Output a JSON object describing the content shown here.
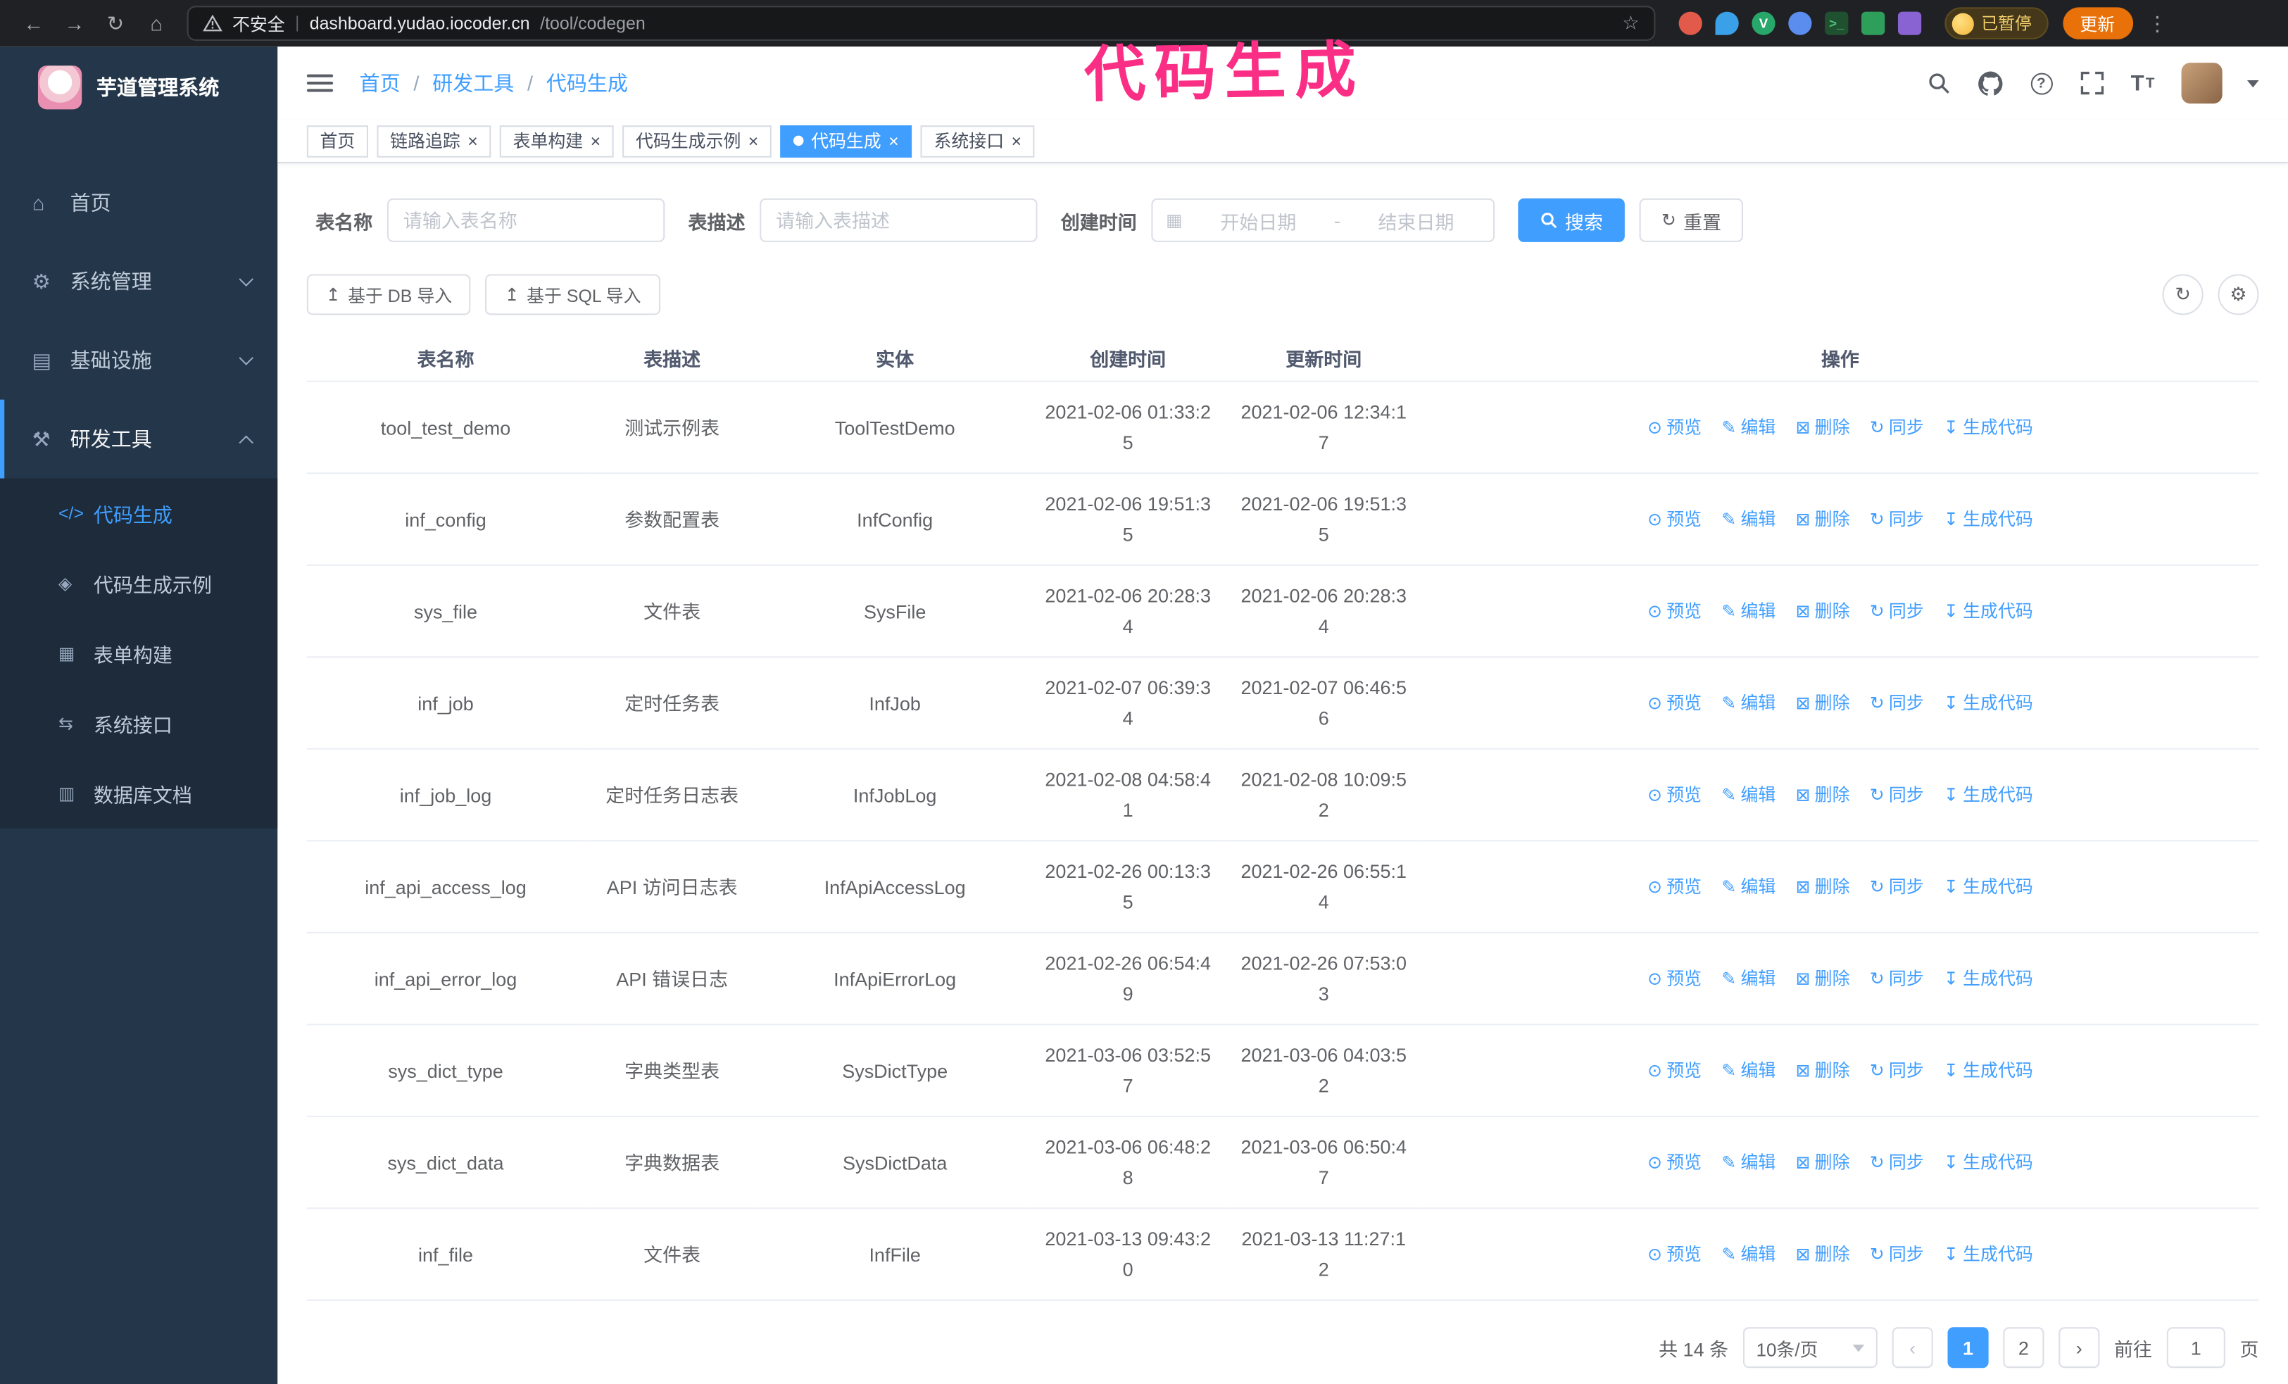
{
  "colors": {
    "accent": "#409eff",
    "annotation_pink": "#fb2e86",
    "sidebar_bg": "#24364a",
    "submenu_bg": "#1d2b3a",
    "update_button_orange": "#e8710a",
    "active_tab_blue": "#409eff"
  },
  "annotation": {
    "text": "代码生成"
  },
  "browser": {
    "security_label": "不安全",
    "url_host": "dashboard.yudao.iocoder.cn",
    "url_path": "/tool/codegen",
    "paused_badge": "已暂停",
    "update_button": "更新"
  },
  "sidebar": {
    "logo_title": "芋道管理系统",
    "items": [
      {
        "label": "首页",
        "icon": "home-icon"
      },
      {
        "label": "系统管理",
        "icon": "system-icon",
        "expandable": true
      },
      {
        "label": "基础设施",
        "icon": "infra-icon",
        "expandable": true
      },
      {
        "label": "研发工具",
        "icon": "tools-icon",
        "expandable": true,
        "expanded": true
      }
    ],
    "submenu": [
      {
        "label": "代码生成",
        "icon": "code-icon",
        "active": true
      },
      {
        "label": "代码生成示例",
        "icon": "example-icon"
      },
      {
        "label": "表单构建",
        "icon": "form-icon"
      },
      {
        "label": "系统接口",
        "icon": "api-icon"
      },
      {
        "label": "数据库文档",
        "icon": "db-icon"
      }
    ]
  },
  "header": {
    "breadcrumb": [
      "首页",
      "研发工具",
      "代码生成"
    ]
  },
  "tabs": [
    {
      "label": "首页",
      "closable": false
    },
    {
      "label": "链路追踪",
      "closable": true
    },
    {
      "label": "表单构建",
      "closable": true
    },
    {
      "label": "代码生成示例",
      "closable": true
    },
    {
      "label": "代码生成",
      "closable": true,
      "active": true
    },
    {
      "label": "系统接口",
      "closable": true
    }
  ],
  "filters": {
    "table_name_label": "表名称",
    "table_name_placeholder": "请输入表名称",
    "table_desc_label": "表描述",
    "table_desc_placeholder": "请输入表描述",
    "create_time_label": "创建时间",
    "date_start_placeholder": "开始日期",
    "date_separator": "-",
    "date_end_placeholder": "结束日期",
    "search_label": "搜索",
    "reset_label": "重置"
  },
  "toolbar": {
    "import_db_label": "基于 DB 导入",
    "import_sql_label": "基于 SQL 导入"
  },
  "table": {
    "columns": [
      "表名称",
      "表描述",
      "实体",
      "创建时间",
      "更新时间",
      "操作"
    ],
    "row_actions": [
      "预览",
      "编辑",
      "删除",
      "同步",
      "生成代码"
    ],
    "rows": [
      {
        "name": "tool_test_demo",
        "desc": "测试示例表",
        "entity": "ToolTestDemo",
        "created": "2021-02-06 01:33:25",
        "updated": "2021-02-06 12:34:17"
      },
      {
        "name": "inf_config",
        "desc": "参数配置表",
        "entity": "InfConfig",
        "created": "2021-02-06 19:51:35",
        "updated": "2021-02-06 19:51:35"
      },
      {
        "name": "sys_file",
        "desc": "文件表",
        "entity": "SysFile",
        "created": "2021-02-06 20:28:34",
        "updated": "2021-02-06 20:28:34"
      },
      {
        "name": "inf_job",
        "desc": "定时任务表",
        "entity": "InfJob",
        "created": "2021-02-07 06:39:34",
        "updated": "2021-02-07 06:46:56"
      },
      {
        "name": "inf_job_log",
        "desc": "定时任务日志表",
        "entity": "InfJobLog",
        "created": "2021-02-08 04:58:41",
        "updated": "2021-02-08 10:09:52"
      },
      {
        "name": "inf_api_access_log",
        "desc": "API 访问日志表",
        "entity": "InfApiAccessLog",
        "created": "2021-02-26 00:13:35",
        "updated": "2021-02-26 06:55:14"
      },
      {
        "name": "inf_api_error_log",
        "desc": "API 错误日志",
        "entity": "InfApiErrorLog",
        "created": "2021-02-26 06:54:49",
        "updated": "2021-02-26 07:53:03"
      },
      {
        "name": "sys_dict_type",
        "desc": "字典类型表",
        "entity": "SysDictType",
        "created": "2021-03-06 03:52:57",
        "updated": "2021-03-06 04:03:52"
      },
      {
        "name": "sys_dict_data",
        "desc": "字典数据表",
        "entity": "SysDictData",
        "created": "2021-03-06 06:48:28",
        "updated": "2021-03-06 06:50:47"
      },
      {
        "name": "inf_file",
        "desc": "文件表",
        "entity": "InfFile",
        "created": "2021-03-13 09:43:20",
        "updated": "2021-03-13 11:27:12"
      }
    ]
  },
  "pagination": {
    "total_label": "共 14 条",
    "page_size": "10条/页",
    "pages": [
      "1",
      "2"
    ],
    "active_page": "1",
    "goto_label": "前往",
    "goto_value": "1",
    "goto_suffix": "页"
  }
}
